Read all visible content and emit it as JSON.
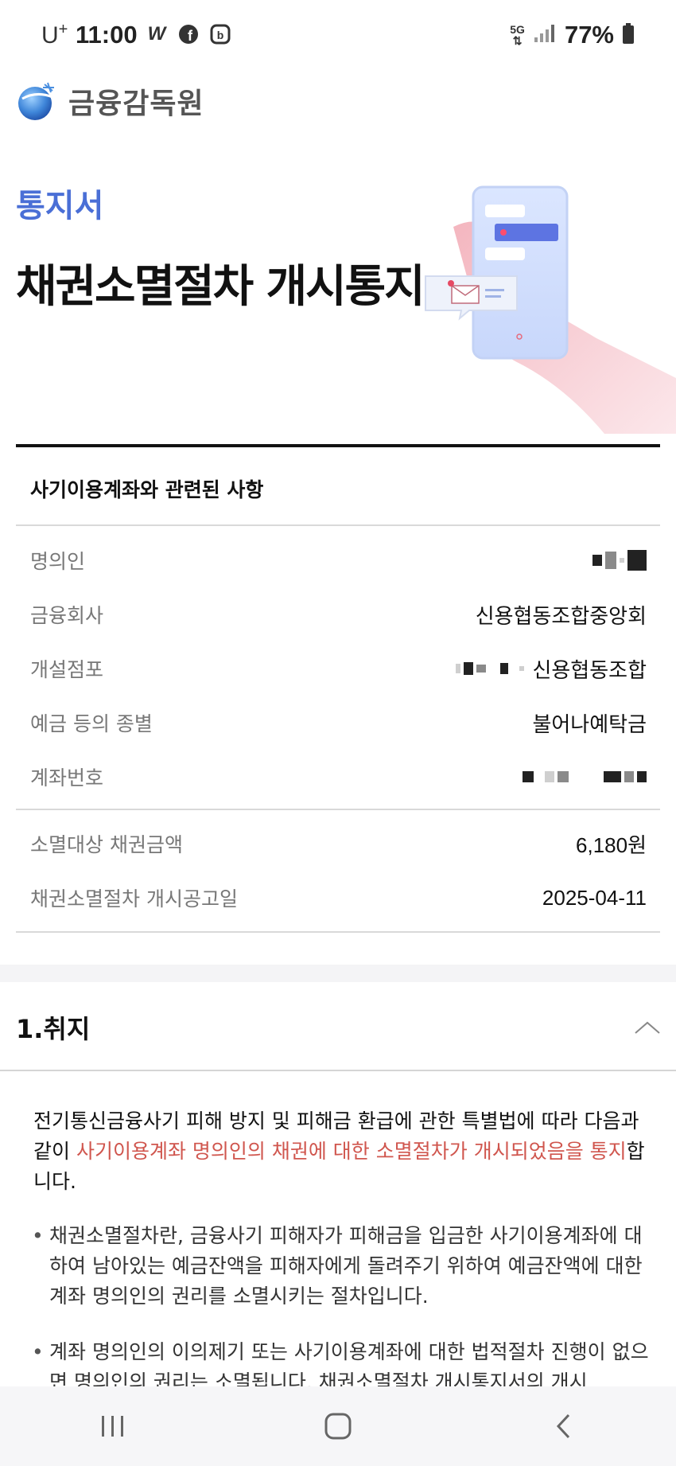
{
  "status_bar": {
    "carrier": "U",
    "carrier_sup": "+",
    "time": "11:00",
    "icons": [
      "w-icon",
      "facebook-icon",
      "band-icon"
    ],
    "network": "5G",
    "battery": "77%"
  },
  "header": {
    "org_name": "금융감독원"
  },
  "hero": {
    "subtitle": "통지서",
    "title": "채권소멸절차 개시통지"
  },
  "account_section": {
    "heading": "사기이용계좌와 관련된 사항",
    "rows": [
      {
        "label": "명의인",
        "value": ""
      },
      {
        "label": "금융회사",
        "value": "신용협동조합중앙회"
      },
      {
        "label": "개설점포",
        "value": "신용협동조합"
      },
      {
        "label": "예금 등의 종별",
        "value": "불어나예탁금"
      },
      {
        "label": "계좌번호",
        "value": ""
      }
    ],
    "claim_rows": [
      {
        "label": "소멸대상 채권금액",
        "value": "6,180원"
      },
      {
        "label": "채권소멸절차 개시공고일",
        "value": "2025-04-11"
      }
    ]
  },
  "accordion": {
    "title": "1.취지",
    "intro_before": "전기통신금융사기 피해 방지 및 피해금 환급에 관한 특별법에 따라 다음과 같이 ",
    "intro_highlight": "사기이용계좌 명의인의 채권에 대한 소멸절차가 개시되었음을 통지",
    "intro_after": "합니다.",
    "bullets": [
      "채권소멸절차란, 금융사기 피해자가 피해금을 입금한 사기이용계좌에 대하여 남아있는 예금잔액을 피해자에게 돌려주기 위하여 예금잔액에 대한 계좌 명의인의 권리를 소멸시키는 절차입니다.",
      "계좌 명의인의 이의제기 또는 사기이용계좌에 대한 법적절차 진행이 없으면 명의인의 권리는 소멸됩니다. 채권소멸절차 개시통지서의 개시"
    ]
  },
  "colors": {
    "accent_blue": "#4a6fd6",
    "highlight_red": "#d0564e"
  }
}
